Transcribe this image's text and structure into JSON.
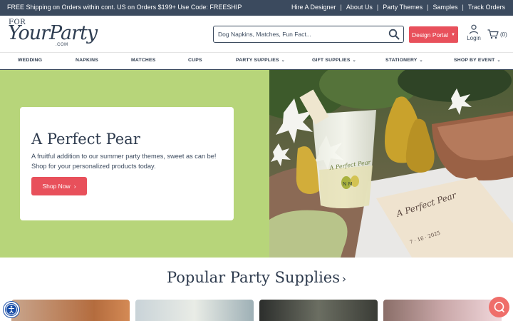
{
  "topbar": {
    "promo": "FREE Shipping on Orders within cont. US on Orders $199+ Use Code: FREESHIP",
    "links": [
      "Hire A Designer",
      "About Us",
      "Party Themes",
      "Samples",
      "Track Orders"
    ]
  },
  "logo": {
    "line1": "FOR",
    "line2": "YourParty",
    "line3": ".COM"
  },
  "search": {
    "placeholder": "Dog Napkins, Matches, Fun Fact..."
  },
  "header": {
    "design_portal": "Design Portal",
    "login": "Login",
    "cart_count": "(0)"
  },
  "nav": {
    "items": [
      "WEDDING",
      "NAPKINS",
      "MATCHES",
      "CUPS",
      "PARTY SUPPLIES",
      "GIFT SUPPLIES",
      "STATIONERY",
      "SHOP BY EVENT"
    ]
  },
  "hero": {
    "title": "A Perfect Pear",
    "text": "A fruitful addition to our summer party themes, sweet as can be! Shop for your personalized products today.",
    "button": "Shop Now",
    "background_color": "#b7d57a",
    "image_cup_text": "A Perfect Pear",
    "image_napkin_text": "A Perfect Pear",
    "image_initials": "N M",
    "image_date": "7 · 16 · 2025"
  },
  "popular": {
    "title": "Popular Party Supplies"
  },
  "colors": {
    "accent": "#e8505b",
    "navy": "#3b4a5e"
  },
  "icons": [
    "search-icon",
    "user-icon",
    "cart-icon",
    "chevron-down-icon",
    "accessibility-icon",
    "chat-icon"
  ]
}
